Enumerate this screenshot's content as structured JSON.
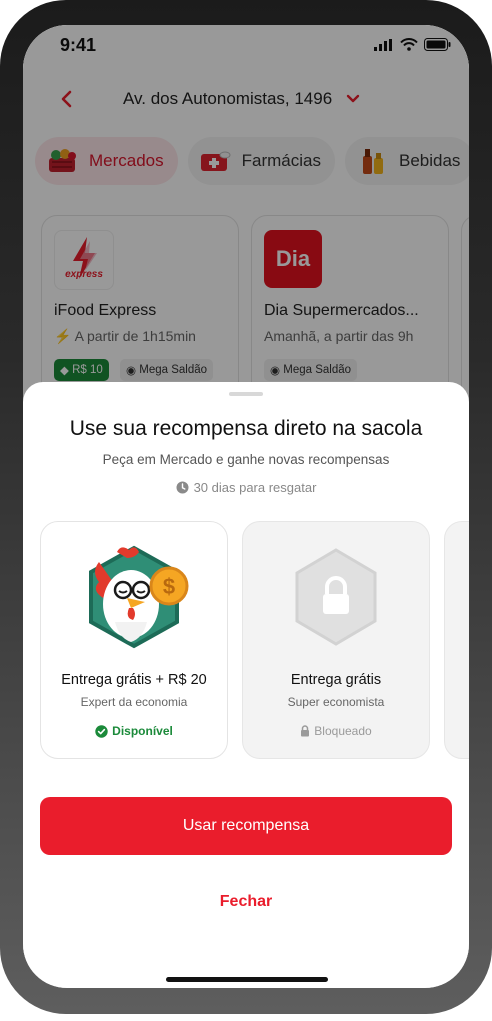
{
  "status_bar": {
    "time": "9:41"
  },
  "header": {
    "address": "Av. dos Autonomistas, 1496"
  },
  "categories": [
    {
      "label": "Mercados",
      "icon": "grocery-basket-icon"
    },
    {
      "label": "Farmácias",
      "icon": "pharmacy-box-icon"
    },
    {
      "label": "Bebidas",
      "icon": "drink-bottles-icon"
    }
  ],
  "stores": [
    {
      "name": "iFood Express",
      "eta": "A partir de 1h15min",
      "logo_text": "express",
      "tags": [
        "R$ 10",
        "Mega Saldão"
      ]
    },
    {
      "name": "Dia Supermercados...",
      "eta": "Amanhã, a partir das 9h",
      "logo_text": "Dia",
      "tags": [
        "Mega Saldão"
      ]
    }
  ],
  "sheet": {
    "title": "Use sua recompensa direto na sacola",
    "subtitle": "Peça em Mercado e ganhe novas recompensas",
    "deadline": "30 dias para resgatar",
    "rewards": [
      {
        "title": "Entrega grátis + R$ 20",
        "subtitle": "Expert da economia",
        "status": "Disponível",
        "icon": "rooster-coin-badge-icon"
      },
      {
        "title": "Entrega grátis",
        "subtitle": "Super economista",
        "status": "Bloqueado",
        "icon": "lock-badge-icon"
      }
    ],
    "primary_button": "Usar recompensa",
    "secondary_button": "Fechar"
  },
  "colors": {
    "brand_red": "#ea1d2c",
    "success_green": "#1b8a3a",
    "muted_gray": "#9a9a9a"
  }
}
